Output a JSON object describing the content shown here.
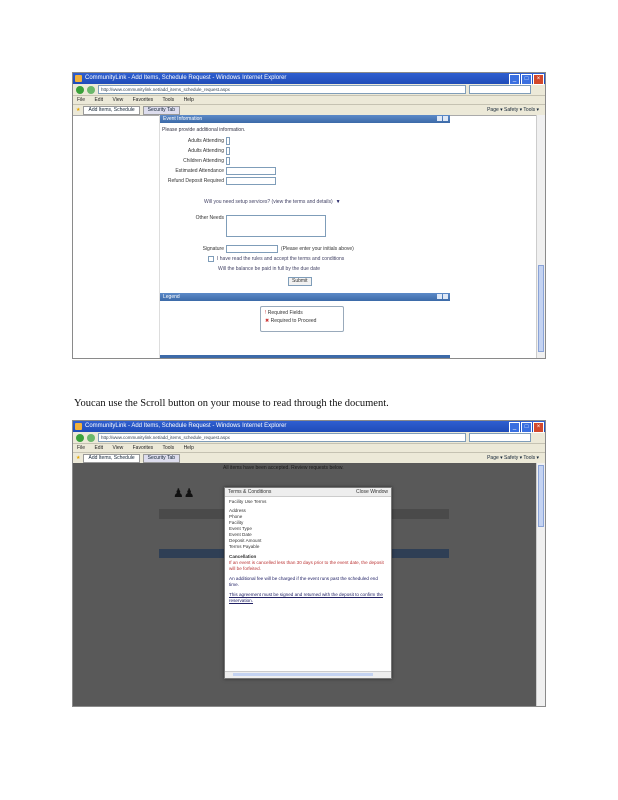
{
  "caption": "Youcan use the Scroll button on your mouse to read through the document.",
  "screenshot1": {
    "title": "CommunityLink - Add Items, Schedule Request - Windows Internet Explorer",
    "url": "http://www.communitylink.net/add_items_schedule_request.aspx",
    "menu": [
      "File",
      "Edit",
      "View",
      "Favorites",
      "Tools",
      "Help"
    ],
    "tabs": [
      "Add Items, Schedule",
      "Security Tab"
    ],
    "tools_label": "Page ▾ Safety ▾ Tools ▾",
    "panel_title": "Event Information",
    "intro": "Please provide additional information.",
    "fields": [
      "Adults Attending",
      "Adults Attending",
      "Children Attending",
      "Estimated Attendance",
      "Refund Deposit Required"
    ],
    "question": "Will you need setup services? (view the terms and details)",
    "other_needs_label": "Other Needs",
    "signature_label": "Signature",
    "signature_hint": "(Please enter your initials above)",
    "agree_text": "I have read the rules and accept the terms and conditions",
    "total_text": "Will the balance be paid in full by the due date",
    "submit_label": "Submit",
    "legend_title": "Legend",
    "legend_items": [
      "Required Fields",
      "Required to Proceed"
    ]
  },
  "screenshot2": {
    "title": "CommunityLink - Add Items, Schedule Request - Windows Internet Explorer",
    "url": "http://www.communitylink.net/add_items_schedule_request.aspx",
    "menu": [
      "File",
      "Edit",
      "View",
      "Favorites",
      "Tools",
      "Help"
    ],
    "tabs": [
      "Add Items, Schedule",
      "Security Tab"
    ],
    "tools_label": "Page ▾ Safety ▾ Tools ▾",
    "banner": "All items have been accepted. Review requests below.",
    "modal_title": "Terms & Conditions",
    "modal_close": "Close Window",
    "modal_sub": "Facility Use Terms",
    "modal_lines": [
      "Address",
      "Phone",
      "Facility",
      "Event Type",
      "Event Date",
      "Deposit Amount",
      "Terms Payable"
    ],
    "modal_paragraph_title": "Cancellation",
    "modal_paragraph": "If an event is cancelled less than 30 days prior to the event date, the deposit will be forfeited.",
    "modal_paragraph2": "An additional fee will be charged if the event runs past the scheduled end time.",
    "modal_note": "This agreement must be signed and returned with the deposit to confirm the reservation."
  }
}
